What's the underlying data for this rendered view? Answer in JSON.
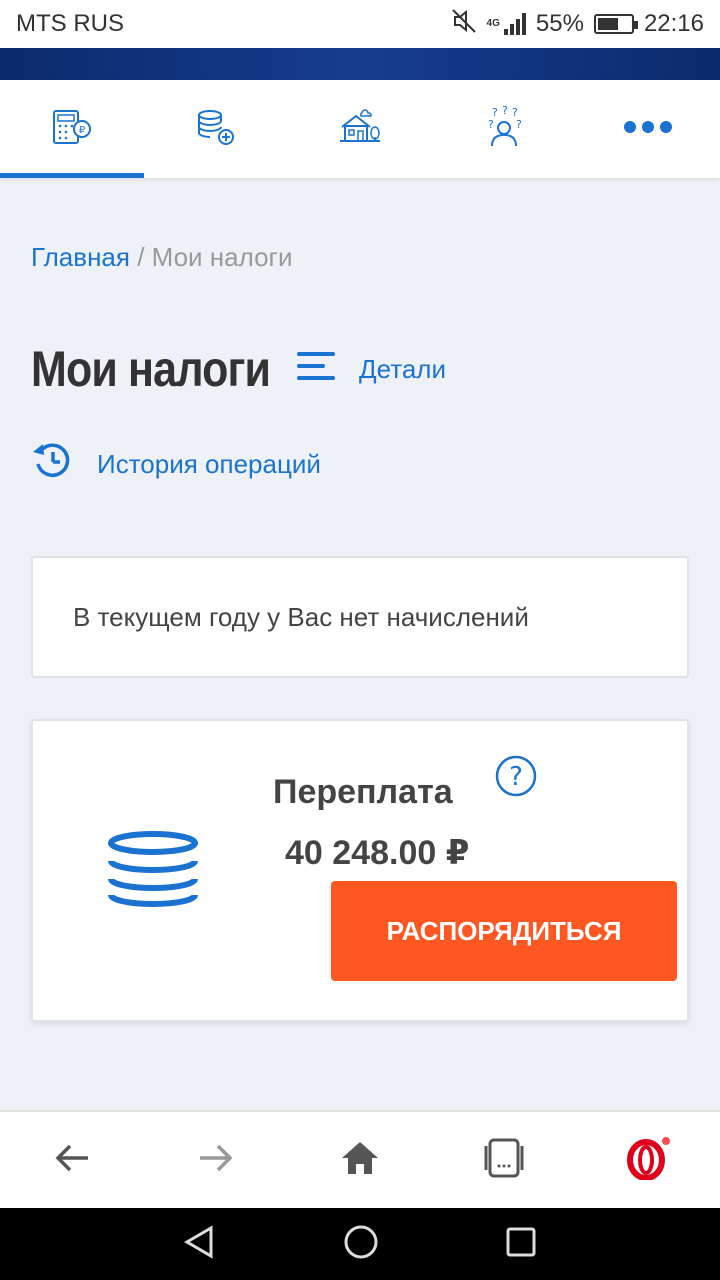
{
  "status_bar": {
    "carrier": "MTS RUS",
    "network": "4G",
    "battery": "55%",
    "battery_level": 0.55,
    "time": "22:16"
  },
  "top_nav": {
    "items": [
      {
        "icon": "calculator-ruble-icon",
        "active": true
      },
      {
        "icon": "coins-plus-icon",
        "active": false
      },
      {
        "icon": "property-icon",
        "active": false
      },
      {
        "icon": "questions-person-icon",
        "active": false
      },
      {
        "icon": "more-dots-icon",
        "active": false
      }
    ]
  },
  "breadcrumb": {
    "home": "Главная",
    "separator": " / ",
    "current": "Мои налоги"
  },
  "page": {
    "title": "Мои налоги",
    "details_label": "Детали",
    "history_label": "История операций"
  },
  "info_card": {
    "text": "В текущем году у Вас нет начислений"
  },
  "overpayment_card": {
    "title": "Переплата",
    "amount": "40 248.00 ₽",
    "button_label": "РАСПОРЯДИТЬСЯ"
  },
  "browser_bar": {
    "items": [
      "back-arrow-icon",
      "forward-arrow-icon",
      "home-icon",
      "tabs-icon",
      "opera-icon"
    ]
  },
  "colors": {
    "accent": "#1a73d0",
    "button": "#ff5722",
    "background": "#eef2f7",
    "opera": "#e0001b"
  }
}
